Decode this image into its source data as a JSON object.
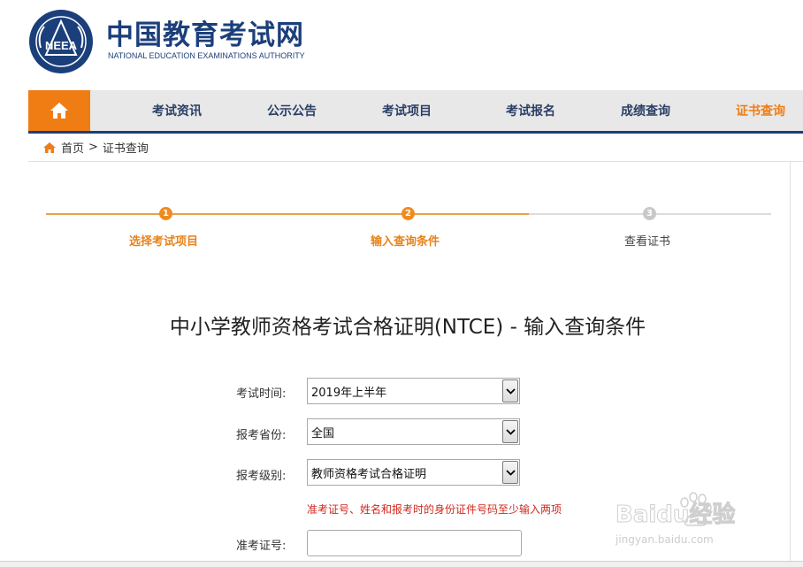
{
  "header": {
    "logo_title": "中国教育考试网",
    "logo_subtitle": "NATIONAL EDUCATION EXAMINATIONS AUTHORITY",
    "emblem_text": "NEEA"
  },
  "nav": {
    "home_icon": "home-icon",
    "items": [
      {
        "label": "考试资讯",
        "active": false
      },
      {
        "label": "公示公告",
        "active": false
      },
      {
        "label": "考试项目",
        "active": false
      },
      {
        "label": "考试报名",
        "active": false
      },
      {
        "label": "成绩查询",
        "active": false
      },
      {
        "label": "证书查询",
        "active": true
      }
    ]
  },
  "breadcrumb": {
    "home": "首页",
    "separator": ">",
    "current": "证书查询"
  },
  "steps": [
    {
      "number": "1",
      "label": "选择考试项目",
      "state": "done"
    },
    {
      "number": "2",
      "label": "输入查询条件",
      "state": "current"
    },
    {
      "number": "3",
      "label": "查看证书",
      "state": "todo"
    }
  ],
  "page_title": "中小学教师资格考试合格证明(NTCE) - 输入查询条件",
  "form": {
    "exam_time": {
      "label": "考试时间:",
      "value": "2019年上半年"
    },
    "province": {
      "label": "报考省份:",
      "value": "全国"
    },
    "level": {
      "label": "报考级别:",
      "value": "教师资格考试合格证明"
    },
    "hint": "准考证号、姓名和报考时的身份证件号码至少输入两项",
    "ticket_no": {
      "label": "准考证号:",
      "value": "",
      "placeholder": ""
    }
  },
  "watermark": {
    "brand": "Baidu经验",
    "url": "jingyan.baidu.com"
  },
  "colors": {
    "brand_blue": "#1b3f7a",
    "accent_orange": "#f07d14",
    "hint_red": "#d1281e"
  }
}
